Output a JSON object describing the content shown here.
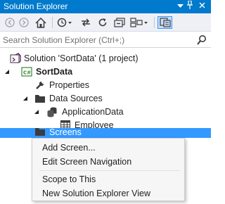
{
  "window": {
    "title": "Solution Explorer",
    "dropdown_icon": "dropdown-arrow",
    "pin_icon": "pin",
    "close_icon": "close"
  },
  "toolbar": {
    "buttons": [
      "back",
      "forward",
      "home",
      "history",
      "sync",
      "refresh",
      "collapse",
      "show-all-files",
      "switch-views"
    ]
  },
  "search": {
    "placeholder": "Search Solution Explorer (Ctrl+;)"
  },
  "tree": {
    "solution": "Solution 'SortData' (1 project)",
    "project": "SortData",
    "properties": "Properties",
    "data_sources": "Data Sources",
    "application_data": "ApplicationData",
    "employee": "Employee",
    "screens": "Screens"
  },
  "context_menu": {
    "items": [
      "Add Screen...",
      "Edit Screen Navigation",
      "Scope to This",
      "New Solution Explorer View"
    ]
  },
  "colors": {
    "accent": "#007acc",
    "selection": "#3399ff",
    "toolbar_bg": "#eef0f6"
  }
}
